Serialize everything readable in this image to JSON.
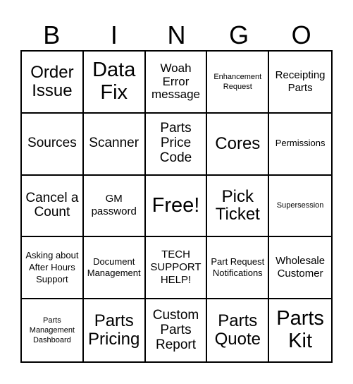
{
  "header": {
    "letters": [
      "B",
      "I",
      "N",
      "G",
      "O"
    ]
  },
  "cells": [
    {
      "text": "Order Issue",
      "size": "l"
    },
    {
      "text": "Data Fix",
      "size": "xl"
    },
    {
      "text": "Woah Error message",
      "size": "ms"
    },
    {
      "text": "Enhancement Request",
      "size": "xxs"
    },
    {
      "text": "Receipting Parts",
      "size": "s"
    },
    {
      "text": "Sources",
      "size": "m"
    },
    {
      "text": "Scanner",
      "size": "m"
    },
    {
      "text": "Parts Price Code",
      "size": "m"
    },
    {
      "text": "Cores",
      "size": "l"
    },
    {
      "text": "Permissions",
      "size": "xs"
    },
    {
      "text": "Cancel a Count",
      "size": "m"
    },
    {
      "text": "GM password",
      "size": "s"
    },
    {
      "text": "Free!",
      "size": "xl"
    },
    {
      "text": "Pick Ticket",
      "size": "l"
    },
    {
      "text": "Supersession",
      "size": "xxs"
    },
    {
      "text": "Asking about After Hours Support",
      "size": "xs"
    },
    {
      "text": "Document Management",
      "size": "xs"
    },
    {
      "text": "TECH SUPPORT HELP!",
      "size": "s"
    },
    {
      "text": "Part Request Notifications",
      "size": "xs"
    },
    {
      "text": "Wholesale Customer",
      "size": "s"
    },
    {
      "text": "Parts Management Dashboard",
      "size": "xxs"
    },
    {
      "text": "Parts Pricing",
      "size": "l"
    },
    {
      "text": "Custom Parts Report",
      "size": "m"
    },
    {
      "text": "Parts Quote",
      "size": "l"
    },
    {
      "text": "Parts Kit",
      "size": "xl"
    }
  ]
}
